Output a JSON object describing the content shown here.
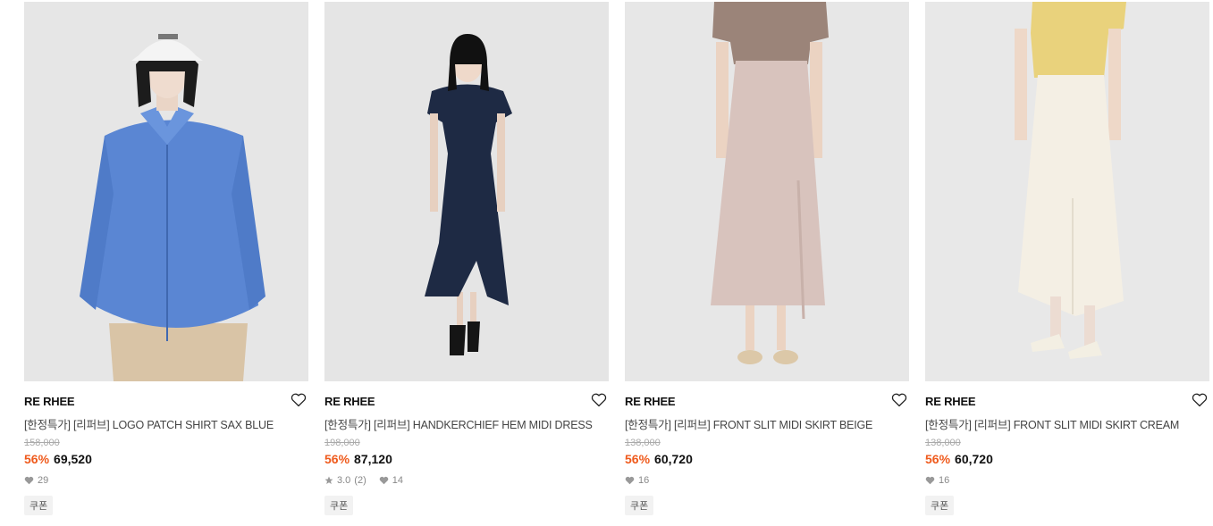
{
  "products": [
    {
      "brand": "RE RHEE",
      "name": "[한정특가] [리퍼브] LOGO PATCH SHIRT SAX BLUE",
      "original_price": "158,000",
      "discount": "56%",
      "sale_price": "69,520",
      "rating": "",
      "review_count": "",
      "likes": "29",
      "coupon_label": "쿠폰",
      "image": "model in blue shirt"
    },
    {
      "brand": "RE RHEE",
      "name": "[한정특가] [리퍼브] HANDKERCHIEF HEM MIDI DRESS",
      "original_price": "198,000",
      "discount": "56%",
      "sale_price": "87,120",
      "rating": "3.0",
      "review_count": "(2)",
      "likes": "14",
      "coupon_label": "쿠폰",
      "image": "model in navy midi dress"
    },
    {
      "brand": "RE RHEE",
      "name": "[한정특가] [리퍼브] FRONT SLIT MIDI SKIRT BEIGE",
      "original_price": "138,000",
      "discount": "56%",
      "sale_price": "60,720",
      "rating": "",
      "review_count": "",
      "likes": "16",
      "coupon_label": "쿠폰",
      "image": "model in beige midi skirt"
    },
    {
      "brand": "RE RHEE",
      "name": "[한정특가] [리퍼브] FRONT SLIT MIDI SKIRT CREAM",
      "original_price": "138,000",
      "discount": "56%",
      "sale_price": "60,720",
      "rating": "",
      "review_count": "",
      "likes": "16",
      "coupon_label": "쿠폰",
      "image": "model in cream midi skirt"
    }
  ],
  "colors": {
    "discount": "#ef5a1c",
    "image_bg": "#e4e4e4"
  },
  "icons": {
    "wishlist": "heart-outline-icon",
    "likes": "heart-filled-icon",
    "rating": "star-icon"
  }
}
